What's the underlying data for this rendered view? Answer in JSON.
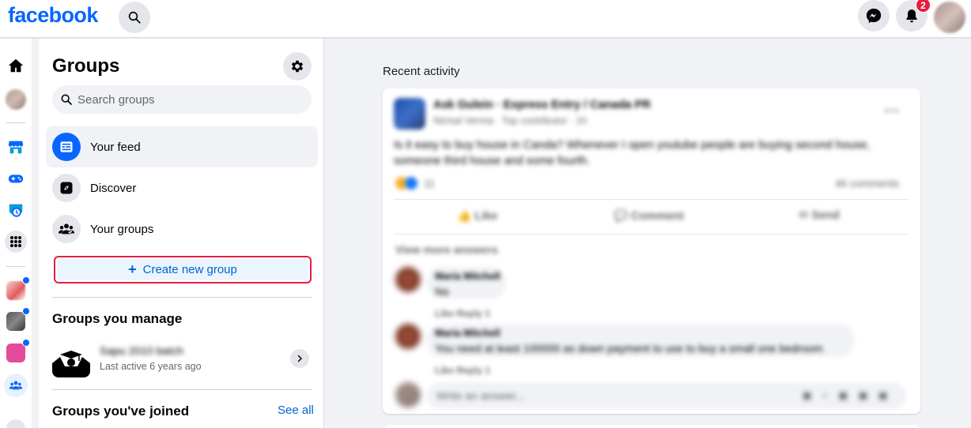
{
  "topbar": {
    "logo": "facebook",
    "notifications_badge": "2"
  },
  "sidebar": {
    "title": "Groups",
    "search_placeholder": "Search groups",
    "nav": [
      {
        "label": "Your feed"
      },
      {
        "label": "Discover"
      },
      {
        "label": "Your groups"
      }
    ],
    "create_button": "Create new group",
    "manage_title": "Groups you manage",
    "managed_group": {
      "name": "Sapu 2010 batch",
      "subtitle": "Last active 6 years ago"
    },
    "joined_title": "Groups you've joined",
    "see_all": "See all"
  },
  "feed": {
    "section_title": "Recent activity",
    "post": {
      "author": "Ask Gulein · Express Entry / Canada PR",
      "meta": "Nirmal Verma · Top contributor · 1h",
      "body": "Is it easy to buy house in Canda? Whenever I open youtube people are buying second house, someone third house and some fourth.",
      "reactions_count": "11",
      "comments_count": "46 comments",
      "actions": {
        "like": "Like",
        "comment": "Comment",
        "send": "Send"
      },
      "view_more": "View more answers",
      "comments": [
        {
          "author": "Maria Mitchell",
          "text": "No",
          "actions": "Like  Reply  1"
        },
        {
          "author": "Maria Mitchell",
          "text": "You need at least 100000 as down payment to use to buy a small one bedroom",
          "actions": "Like  Reply  1"
        }
      ],
      "reply_placeholder": "Write an answer..."
    }
  },
  "colors": {
    "brand": "#0866ff",
    "link": "#0064d1",
    "badge": "#e41e3f",
    "highlight_border": "#e41e3f"
  }
}
